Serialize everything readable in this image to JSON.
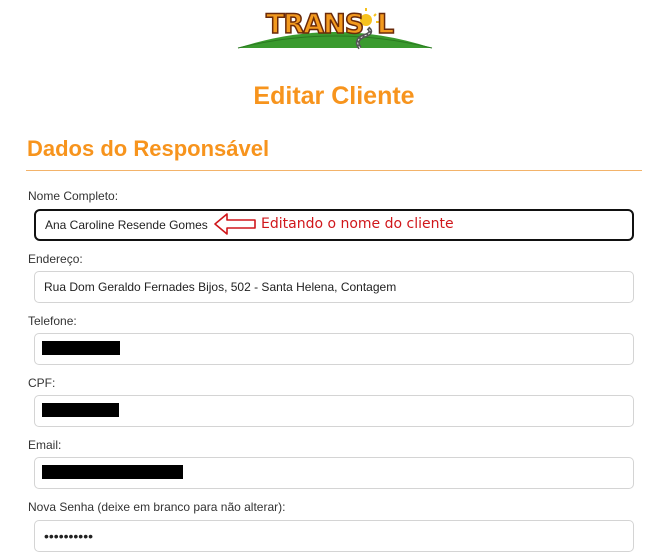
{
  "logo": {
    "text": "TRANS",
    "text_tail": "L"
  },
  "page": {
    "title": "Editar Cliente"
  },
  "section": {
    "title": "Dados do Responsável"
  },
  "fields": {
    "nome": {
      "label": "Nome Completo:",
      "value": "Ana Caroline Resende Gomes"
    },
    "endereco": {
      "label": "Endereço:",
      "value": "Rua Dom Geraldo Fernades Bijos, 502 - Santa Helena, Contagem"
    },
    "telefone": {
      "label": "Telefone:",
      "value": ""
    },
    "cpf": {
      "label": "CPF:",
      "value": ""
    },
    "email": {
      "label": "Email:",
      "value": ""
    },
    "senha": {
      "label": "Nova Senha (deixe em branco para não alterar):",
      "value": "••••••••••"
    }
  },
  "annotation": {
    "text": "Editando o nome do cliente",
    "color": "#d0171b"
  },
  "colors": {
    "accent": "#f7941d",
    "logo_green": "#3a9a2e",
    "logo_text": "#f39a1f"
  }
}
